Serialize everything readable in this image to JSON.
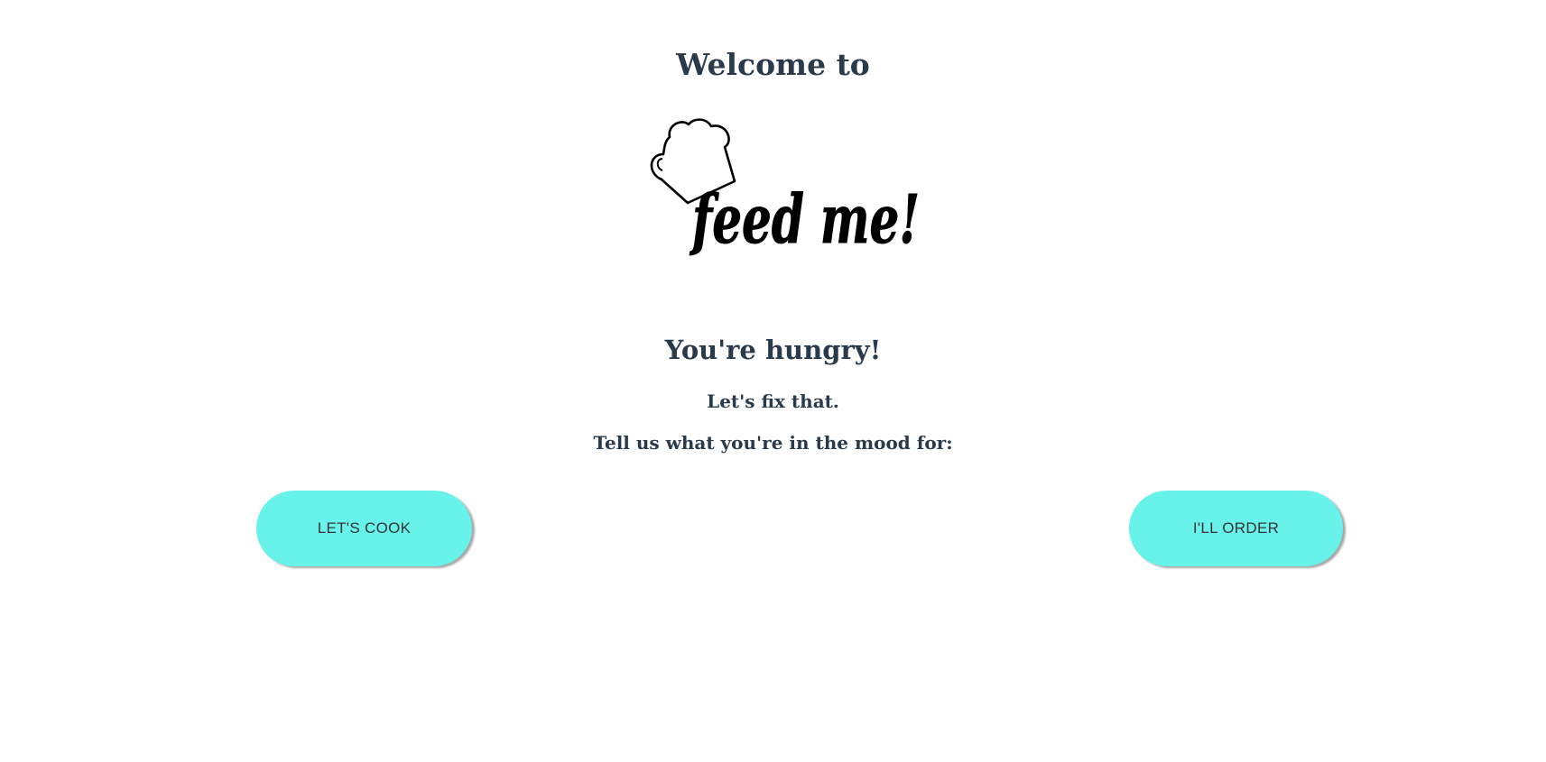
{
  "header": {
    "welcome_text": "Welcome to"
  },
  "logo": {
    "text": "feed me!",
    "icon": "chef-hat-icon"
  },
  "main": {
    "headline": "You're hungry!",
    "subline": "Let's fix that.",
    "prompt": "Tell us what you're in the mood for:"
  },
  "actions": {
    "cook_label": "LET'S COOK",
    "order_label": "I'LL ORDER"
  },
  "colors": {
    "button_background": "#68f3ea",
    "text": "#2a3a4a"
  }
}
